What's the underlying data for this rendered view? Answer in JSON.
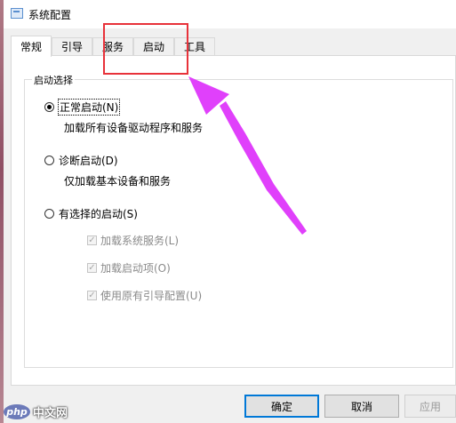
{
  "window": {
    "title": "系统配置"
  },
  "tabs": [
    {
      "label": "常规",
      "active": true
    },
    {
      "label": "引导",
      "active": false
    },
    {
      "label": "服务",
      "active": false
    },
    {
      "label": "启动",
      "active": false
    },
    {
      "label": "工具",
      "active": false
    }
  ],
  "startup_group": {
    "label": "启动选择",
    "options": [
      {
        "label": "正常启动(N)",
        "description": "加载所有设备驱动程序和服务",
        "selected": true
      },
      {
        "label": "诊断启动(D)",
        "description": "仅加载基本设备和服务",
        "selected": false
      },
      {
        "label": "有选择的启动(S)",
        "selected": false
      }
    ],
    "checkboxes": [
      {
        "label": "加载系统服务(L)",
        "checked": true,
        "enabled": false
      },
      {
        "label": "加载启动项(O)",
        "checked": true,
        "enabled": false
      },
      {
        "label": "使用原有引导配置(U)",
        "checked": true,
        "enabled": false
      }
    ]
  },
  "buttons": {
    "ok": "确定",
    "cancel": "取消",
    "apply": "应用"
  },
  "icons": {
    "check_glyph": "✓"
  },
  "watermark": {
    "badge": "php",
    "text": "中文网"
  },
  "colors": {
    "highlight_box": "#e8323a",
    "arrow": "#e040fb",
    "default_button_border": "#0078d7"
  }
}
